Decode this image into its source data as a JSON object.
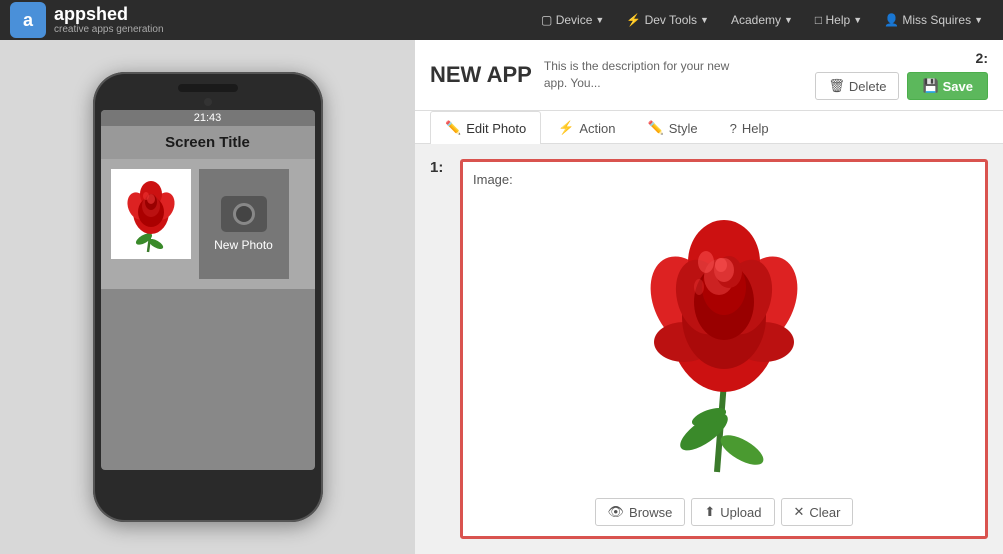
{
  "navbar": {
    "logo_letter": "a",
    "logo_name": "ppshed",
    "logo_tagline": "creative apps generation",
    "nav_items": [
      {
        "label": "Device",
        "has_caret": true
      },
      {
        "label": "Dev Tools",
        "has_caret": true
      },
      {
        "label": "Academy",
        "has_caret": true
      },
      {
        "label": "Help",
        "has_caret": true
      },
      {
        "label": "Miss Squires",
        "has_caret": true,
        "icon": "user"
      }
    ]
  },
  "app_header": {
    "title": "NEW APP",
    "description": "This is the description for your new app. You...",
    "step2_label": "2:",
    "delete_label": "Delete",
    "save_label": "Save"
  },
  "tabs": [
    {
      "id": "edit-photo",
      "label": "Edit Photo",
      "icon": "✏️",
      "active": true
    },
    {
      "id": "action",
      "label": "Action",
      "icon": "⚡"
    },
    {
      "id": "style",
      "label": "Style",
      "icon": "✏️"
    },
    {
      "id": "help",
      "label": "Help",
      "icon": "?"
    }
  ],
  "phone_preview": {
    "status_time": "21:43",
    "screen_title": "Screen Title",
    "new_photo_label": "New Photo"
  },
  "edit_photo": {
    "step1_label": "1:",
    "image_label": "Image:",
    "browse_label": "Browse",
    "upload_label": "Upload",
    "clear_label": "Clear"
  }
}
